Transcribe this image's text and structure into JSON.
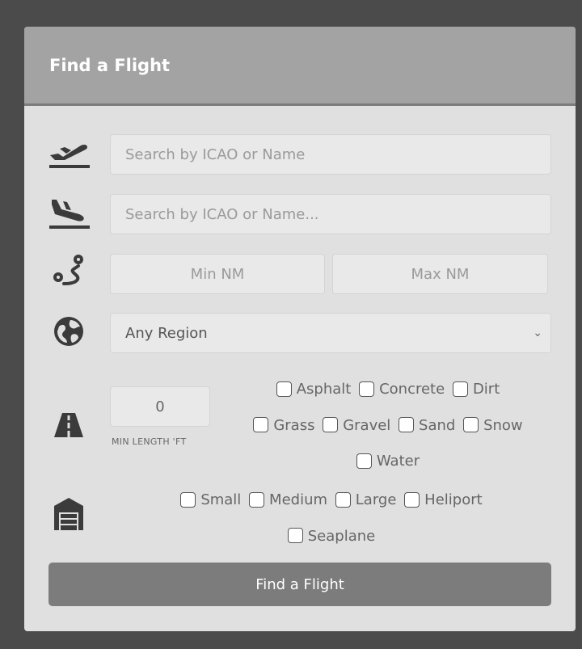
{
  "card": {
    "title": "Find a Flight"
  },
  "departure": {
    "icon": "plane-departure-icon",
    "placeholder": "Search by ICAO or Name"
  },
  "arrival": {
    "icon": "plane-arrival-icon",
    "placeholder": "Search by ICAO or Name..."
  },
  "distance": {
    "icon": "route-icon",
    "min_placeholder": "Min NM",
    "max_placeholder": "Max NM"
  },
  "region": {
    "icon": "globe-icon",
    "selected": "Any Region",
    "chevron": "⌄"
  },
  "runway": {
    "icon": "runway-road-icon",
    "min_length_value": "0",
    "min_length_label": "MIN LENGTH 'FT",
    "surfaces": [
      "Asphalt",
      "Concrete",
      "Dirt",
      "Grass",
      "Gravel",
      "Sand",
      "Snow",
      "Water"
    ]
  },
  "airport_size": {
    "icon": "hangar-icon",
    "options": [
      "Small",
      "Medium",
      "Large",
      "Heliport",
      "Seaplane"
    ]
  },
  "submit": {
    "label": "Find a Flight"
  }
}
